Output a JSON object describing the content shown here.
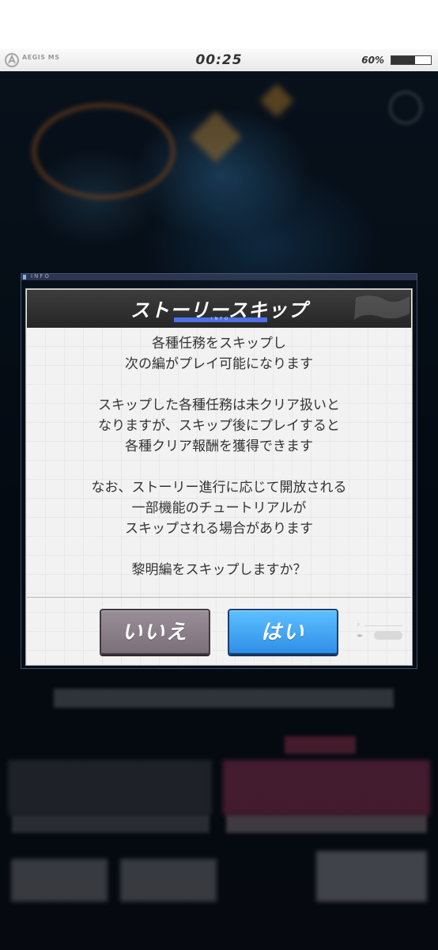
{
  "hud": {
    "logo_text": "AEGIS MS",
    "logo_subtext": "",
    "timer": "00:25",
    "battery_text": "60%",
    "battery_level": 0.6
  },
  "info_panel": {
    "label": "INFO"
  },
  "dialog": {
    "title": "ストーリースキップ",
    "title_sub": "INFO",
    "paragraphs": [
      [
        "各種任務をスキップし",
        "次の編がプレイ可能になります"
      ],
      [
        "スキップした各種任務は未クリア扱いと",
        "なりますが、スキップ後にプレイすると",
        "各種クリア報酬を獲得できます"
      ],
      [
        "なお、ストーリー進行に応じて開放される",
        "一部機能のチュートリアルが",
        "スキップされる場合があります"
      ],
      [
        "黎明編をスキップしますか？"
      ]
    ],
    "no_label": "いいえ",
    "yes_label": "はい"
  },
  "colors": {
    "accent_blue": "#4f6fe6",
    "yes_button": "#3a9cf0",
    "no_button": "#8a7f88",
    "header": "#2f2f2f"
  }
}
